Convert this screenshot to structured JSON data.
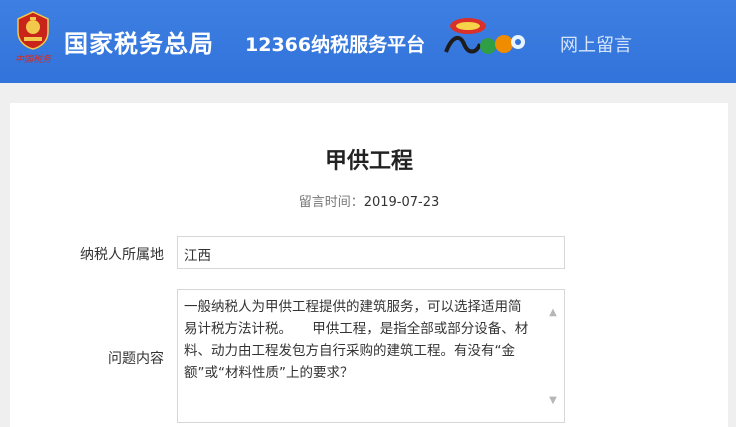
{
  "header": {
    "emblem_caption": "中国税务",
    "title_main": "国家税务总局",
    "title_sub": "12366纳税服务平台",
    "mascot_icon": "12366-mascot-logo",
    "nav_link": "网上留言",
    "colors": {
      "bar": "#3478de",
      "text": "#ffffff"
    }
  },
  "message": {
    "title": "甲供工程",
    "date_label": "留言时间：",
    "date_value": "2019-07-23",
    "location_label": "纳税人所属地",
    "location_value": "江西",
    "question_label": "问题内容",
    "question_text": "一般纳税人为甲供工程提供的建筑服务，可以选择适用简易计税方法计税。　　甲供工程，是指全部或部分设备、材料、动力由工程发包方自行采购的建筑工程。有没有“金额”或“材料性质”上的要求？"
  }
}
